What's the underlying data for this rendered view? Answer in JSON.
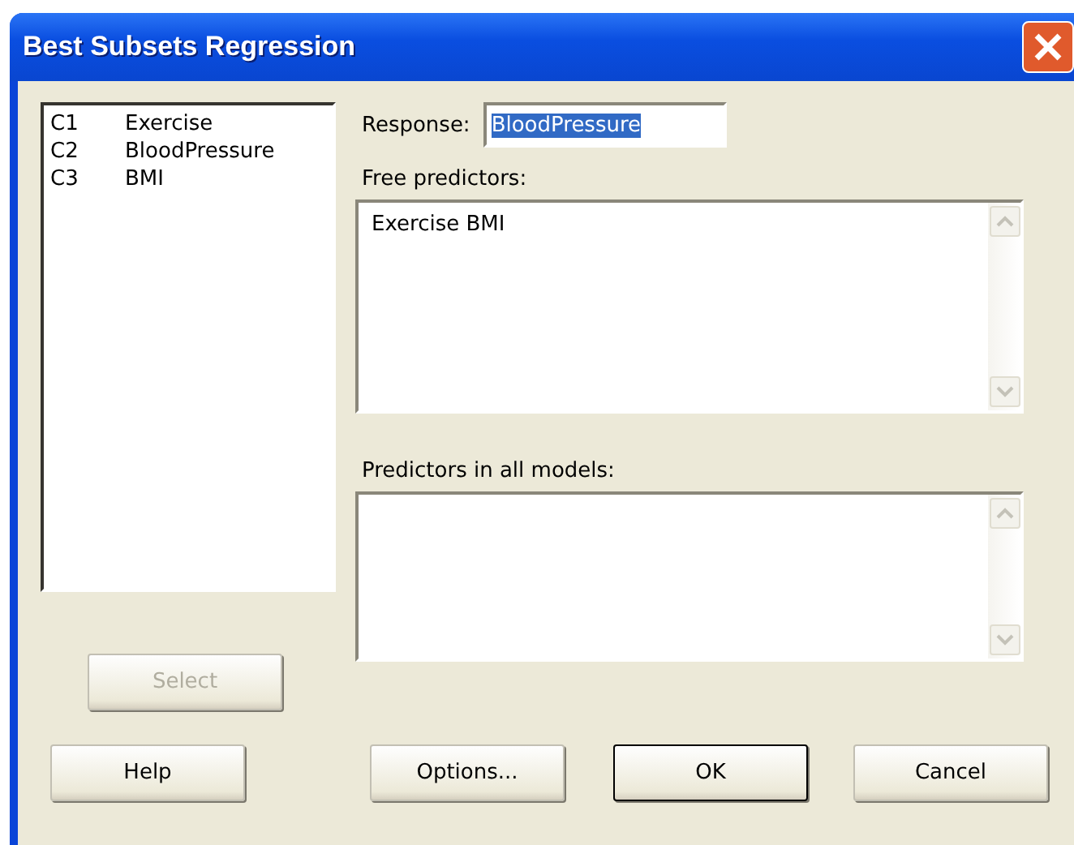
{
  "window": {
    "title": "Best Subsets Regression"
  },
  "columns": [
    {
      "id": "C1",
      "name": "Exercise"
    },
    {
      "id": "C2",
      "name": "BloodPressure"
    },
    {
      "id": "C3",
      "name": "BMI"
    }
  ],
  "select_button": {
    "label": "Select",
    "disabled": true
  },
  "response": {
    "label": "Response:",
    "value": "BloodPressure",
    "selected": true
  },
  "free_predictors": {
    "label": "Free predictors:",
    "value": "Exercise BMI"
  },
  "predictors_in_all_models": {
    "label": "Predictors in all models:"
  },
  "buttons": [
    {
      "label": "Help",
      "default": false
    },
    {
      "label": "Options...",
      "default": false
    },
    {
      "label": "OK",
      "default": true
    },
    {
      "label": "Cancel",
      "default": false
    }
  ]
}
